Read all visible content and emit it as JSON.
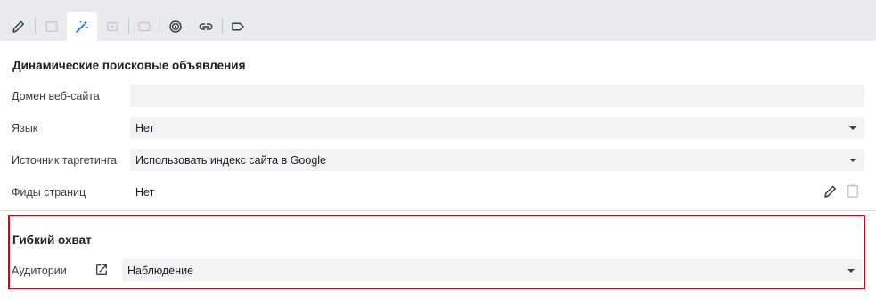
{
  "toolbar": {
    "tools": [
      {
        "icon": "pencil-icon",
        "enabled": true
      },
      {
        "icon": "preview-icon",
        "enabled": false
      },
      {
        "icon": "magic-wand-icon",
        "enabled": true,
        "active": true
      },
      {
        "icon": "copy-icon",
        "enabled": false
      },
      {
        "icon": "comment-icon",
        "enabled": false
      },
      {
        "icon": "target-icon",
        "enabled": true
      },
      {
        "icon": "link-icon",
        "enabled": true
      },
      {
        "icon": "label-icon",
        "enabled": true
      }
    ]
  },
  "dsa": {
    "title": "Динамические поисковые объявления",
    "domain": {
      "label": "Домен веб-сайта",
      "value": ""
    },
    "language": {
      "label": "Язык",
      "value": "Нет"
    },
    "targeting_source": {
      "label": "Источник таргетинга",
      "value": "Использовать индекс сайта в Google"
    },
    "page_feeds": {
      "label": "Фиды страниц",
      "value": "Нет"
    }
  },
  "flexible_reach": {
    "title": "Гибкий охват",
    "audiences": {
      "label": "Аудитории",
      "value": "Наблюдение"
    }
  },
  "colors": {
    "highlight": "#d0021b",
    "active_tool": "#1a73e8"
  }
}
